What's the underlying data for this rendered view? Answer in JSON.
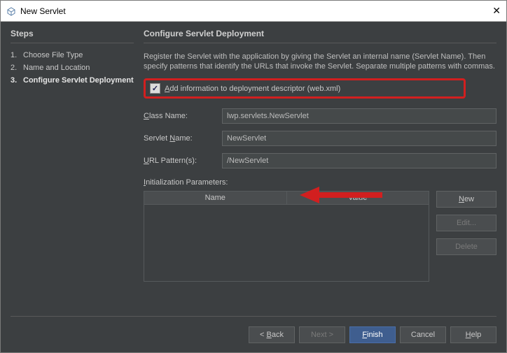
{
  "window": {
    "title": "New Servlet"
  },
  "steps": {
    "heading": "Steps",
    "items": [
      {
        "num": "1.",
        "label": "Choose File Type",
        "current": false
      },
      {
        "num": "2.",
        "label": "Name and Location",
        "current": false
      },
      {
        "num": "3.",
        "label": "Configure Servlet Deployment",
        "current": true
      }
    ]
  },
  "main": {
    "heading": "Configure Servlet Deployment",
    "description": "Register the Servlet with the application by giving the Servlet an internal name (Servlet Name). Then specify patterns that identify the URLs that invoke the Servlet. Separate multiple patterns with commas.",
    "checkbox": {
      "checked": true,
      "prefix": "A",
      "rest": "dd information to deployment descriptor (web.xml)"
    },
    "fields": {
      "className": {
        "labelPrefix": "C",
        "labelRest": "lass Name:",
        "value": "lwp.servlets.NewServlet"
      },
      "servletName": {
        "labelPrefix": "Servlet ",
        "labelU": "N",
        "labelRest": "ame:",
        "value": "NewServlet"
      },
      "urlPattern": {
        "labelU": "U",
        "labelRest": "RL Pattern(s):",
        "value": "/NewServlet"
      }
    },
    "initParams": {
      "label": "Initialization Parameters:",
      "labelU": "I",
      "labelAfter": "nitialization Parameters:",
      "colName": "Name",
      "colValue": "Value"
    },
    "sideButtons": {
      "new": {
        "u": "N",
        "rest": "ew"
      },
      "edit": "Edit...",
      "delete": "Delete"
    }
  },
  "footer": {
    "back": {
      "lt": "< ",
      "u": "B",
      "rest": "ack"
    },
    "next": "Next >",
    "finish": {
      "u": "F",
      "rest": "inish"
    },
    "cancel": "Cancel",
    "help": {
      "u": "H",
      "rest": "elp"
    }
  }
}
